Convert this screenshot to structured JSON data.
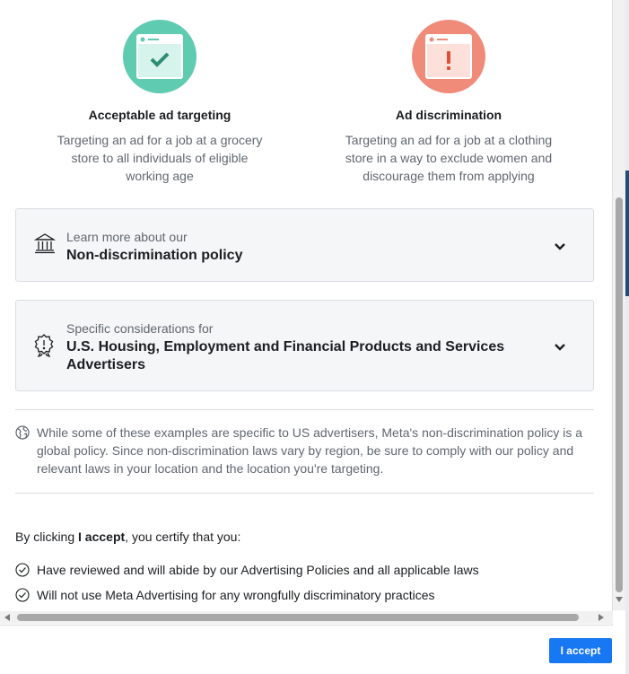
{
  "examples": {
    "acceptable": {
      "title": "Acceptable ad targeting",
      "description": "Targeting an ad for a job at a grocery store to all individuals of eligible working age",
      "color": "#5fcbb1",
      "icon": "browser-check-icon"
    },
    "discrimination": {
      "title": "Ad discrimination",
      "description": "Targeting an ad for a job at a clothing store in a way to exclude women and discourage them from applying",
      "color": "#f08b7a",
      "icon": "browser-warning-icon"
    }
  },
  "cards": [
    {
      "subtitle": "Learn more about our",
      "title": "Non-discrimination policy",
      "icon": "institution-icon"
    },
    {
      "subtitle": "Specific considerations for",
      "title": "U.S. Housing, Employment and Financial Products and Services Advertisers",
      "icon": "badge-alert-icon"
    }
  ],
  "note": {
    "icon": "globe-icon",
    "text": "While some of these examples are specific to US advertisers, Meta's non-discrimination policy is a global policy. Since non-discrimination laws vary by region, be sure to comply with our policy and relevant laws in your location and the location you're targeting."
  },
  "certify": {
    "prefix": "By clicking ",
    "bold": "I accept",
    "suffix": ", you certify that you:",
    "items": [
      "Have reviewed and will abide by our Advertising Policies and all applicable laws",
      "Will not use Meta Advertising for any wrongfully discriminatory practices"
    ]
  },
  "footer": {
    "accept_label": "I accept",
    "accent": "#1877f2"
  }
}
